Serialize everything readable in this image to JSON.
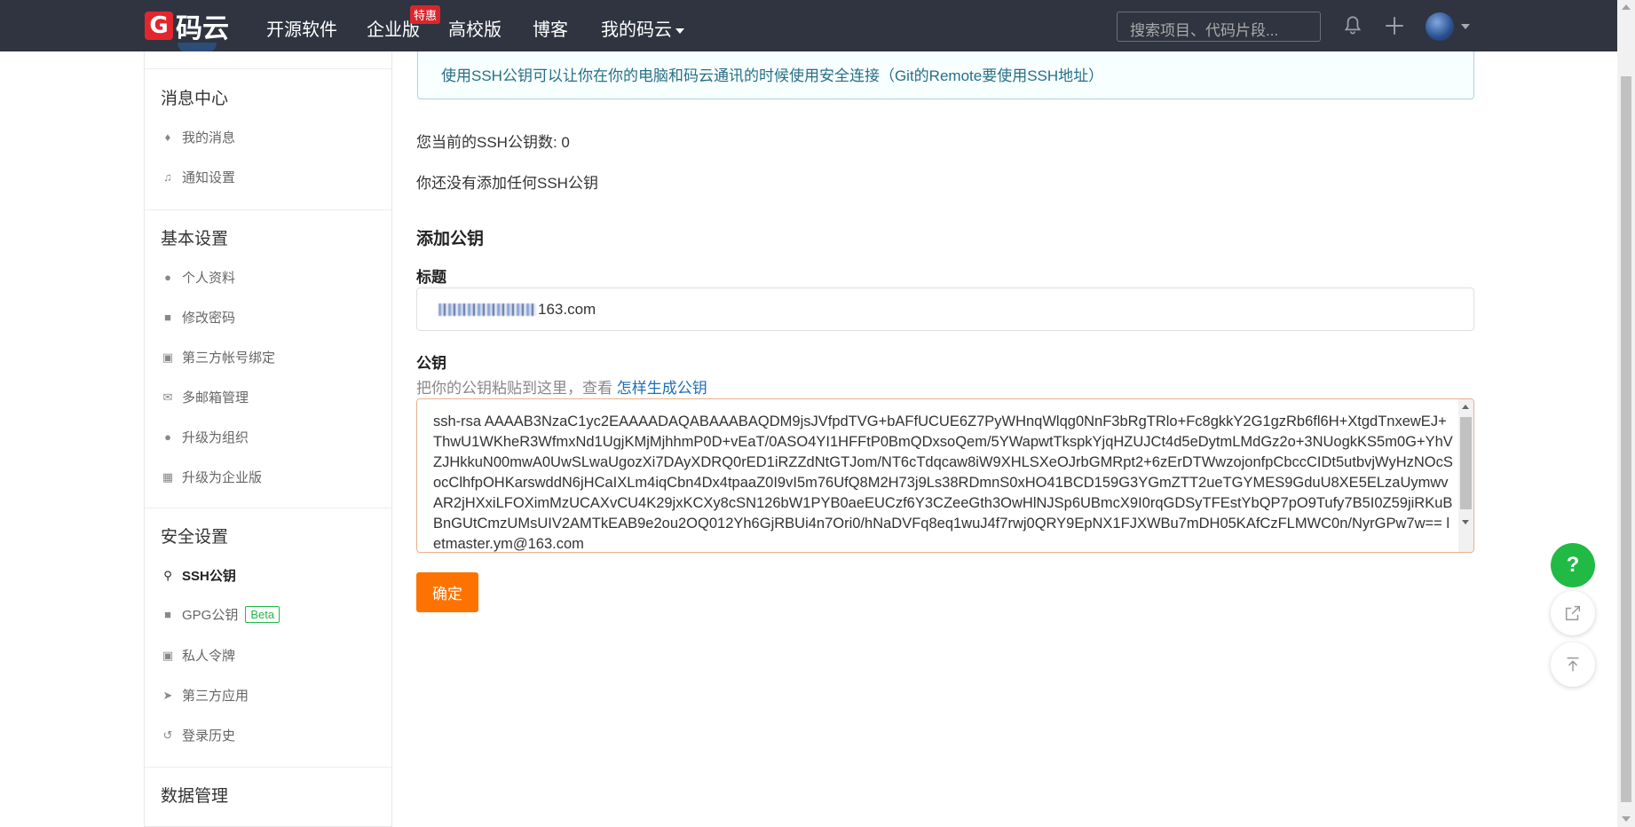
{
  "nav": {
    "logo_letter": "G",
    "logo_text": "码云",
    "links": [
      "开源软件",
      "企业版",
      "高校版",
      "博客",
      "我的码云"
    ],
    "enterprise_badge": "特惠",
    "search_placeholder": "搜索项目、代码片段..."
  },
  "sidebar": {
    "sections": [
      {
        "title": "消息中心",
        "items": [
          {
            "label": "我的消息",
            "icon": "bell-icon"
          },
          {
            "label": "通知设置",
            "icon": "volume-icon"
          }
        ]
      },
      {
        "title": "基本设置",
        "items": [
          {
            "label": "个人资料",
            "icon": "user-icon"
          },
          {
            "label": "修改密码",
            "icon": "unlock-icon"
          },
          {
            "label": "第三方帐号绑定",
            "icon": "contact-icon"
          },
          {
            "label": "多邮箱管理",
            "icon": "mail-icon"
          },
          {
            "label": "升级为组织",
            "icon": "group-icon"
          },
          {
            "label": "升级为企业版",
            "icon": "building-icon"
          }
        ]
      },
      {
        "title": "安全设置",
        "items": [
          {
            "label": "SSH公钥",
            "icon": "key-icon"
          },
          {
            "label": "GPG公钥",
            "icon": "lock-icon",
            "badge": "Beta"
          },
          {
            "label": "私人令牌",
            "icon": "lock-alt-icon"
          },
          {
            "label": "第三方应用",
            "icon": "rocket-icon"
          },
          {
            "label": "登录历史",
            "icon": "history-icon"
          }
        ]
      },
      {
        "title": "数据管理",
        "items": []
      }
    ],
    "active_item": "SSH公钥"
  },
  "main": {
    "info": "使用SSH公钥可以让你在你的电脑和码云通讯的时候使用安全连接（Git的Remote要使用SSH地址）",
    "count_text": "您当前的SSH公钥数: 0",
    "empty_text": "你还没有添加任何SSH公钥",
    "add_heading": "添加公钥",
    "title_label": "标题",
    "title_value_suffix": "163.com",
    "key_label": "公钥",
    "key_hint": "把你的公钥粘贴到这里，查看",
    "key_hint_link": "怎样生成公钥",
    "key_value": "ssh-rsa AAAAB3NzaC1yc2EAAAADAQABAAABAQDM9jsJVfpdTVG+bAFfUCUE6Z7PyWHnqWlqg0NnF3bRgTRlo+Fc8gkkY2G1gzRb6fl6H+XtgdTnxewEJ+ThwU1WKheR3WfmxNd1UgjKMjMjhhmP0D+vEaT/0ASO4YI1HFFtP0BmQDxsoQem/5YWapwtTkspkYjqHZUJCt4d5eDytmLMdGz2o+3NUogkKS5m0G+YhVZJHkkuN00mwA0UwSLwaUgozXi7DAyXDRQ0rED1iRZZdNtGTJom/NT6cTdqcaw8iW9XHLSXeOJrbGMRpt2+6zErDTWwzojonfpCbccCIDt5utbvjWyHzNOcSocClhfpOHKarswddN6jHCaIXLm4iqCbn4Dx4tpaaZ0I9vI5m76UfQ8M2H73j9Ls38RDmnS0xHO41BCD159G3YGmZTT2ueTGYMES9GduU8XE5ELzaUymwvAR2jHXxiLFOXimMzUCAXvCU4K29jxKCXy8cSN126bW1PYB0aeEUCzf6Y3CZeeGth3OwHlNJSp6UBmcX9I0rqGDSyTFEstYbQP7pO9Tufy7B5I0Z59jiRKuBBnGUtCmzUMsUIV2AMTkEAB9e2ou2OQ012Yh6GjRBUi4n7Ori0/hNaDVFq8eq1wuJ4f7rwj0QRY9EpNX1FJXWBu7mDH05KAfCzFLMWC0n/NyrGPw7w== letmaster.ym@163.com",
    "submit_label": "确定"
  },
  "floating": {
    "help": "?"
  }
}
